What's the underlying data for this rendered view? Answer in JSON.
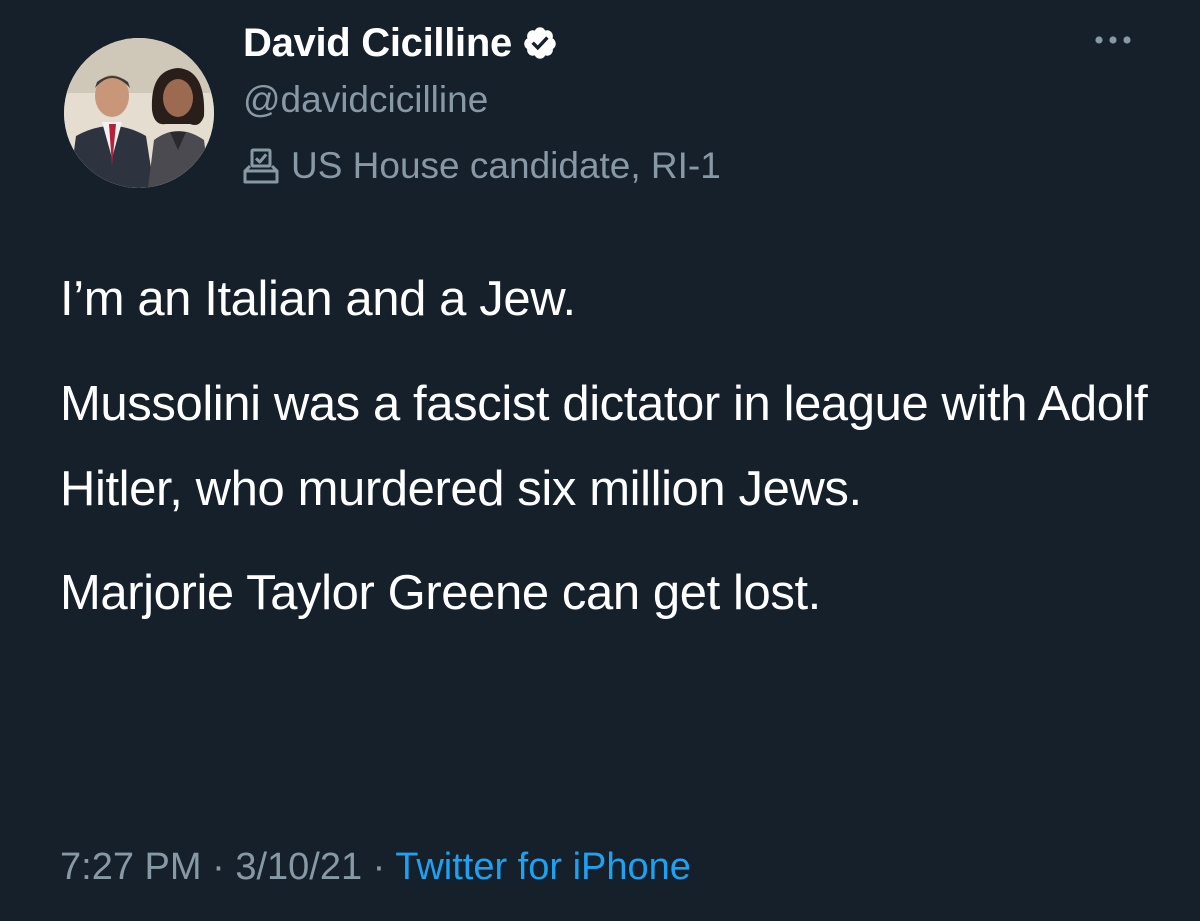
{
  "author": {
    "display_name": "David Cicilline",
    "handle": "@davidcicilline",
    "label": "US House candidate, RI-1",
    "verified": true,
    "label_icon": "ballot-box-icon",
    "verified_icon": "verified-badge-icon"
  },
  "tweet": {
    "paragraphs": [
      "I’m an Italian and a Jew.",
      "Mussolini was a fascist dictator in league with Adolf Hitler, who murdered six million Jews.",
      "Marjorie Taylor Greene can get lost."
    ],
    "time": "7:27 PM",
    "separator": "·",
    "date": "3/10/21",
    "source": "Twitter for iPhone"
  },
  "colors": {
    "background": "#15202b",
    "text": "#ffffff",
    "secondary": "#8899a6",
    "link": "#1da1f2"
  }
}
